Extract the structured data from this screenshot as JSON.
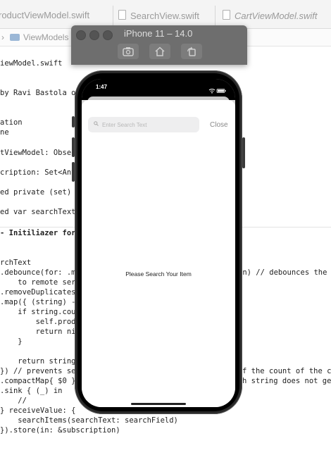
{
  "editor": {
    "tabs": [
      {
        "label": "roductViewModel.swift",
        "italic": false
      },
      {
        "label": "SearchView.swift",
        "italic": false
      },
      {
        "label": "CartViewModel.swift",
        "italic": true
      }
    ],
    "jump_segment": "ViewModels",
    "code_lines": [
      {
        "text": "iewModel.swift",
        "bold": false
      },
      {
        "text": "by Ravi Bastola o",
        "bold": false
      },
      {
        "text": "ation",
        "bold": false
      },
      {
        "text": "ne",
        "bold": false
      },
      {
        "text": "tViewModel: Obser",
        "bold": false
      },
      {
        "text": "cription: Set<Any",
        "bold": false
      },
      {
        "text": "ed private (set) ",
        "bold": false
      },
      {
        "text": "ed var searchText",
        "bold": false
      },
      {
        "text": "- Initiliazer for",
        "bold": true
      },
      {
        "text": "rchText",
        "bold": false
      },
      {
        "text": ".debounce(for: .m",
        "bold": false
      },
      {
        "text": "in) // debounces the",
        "bold": false
      },
      {
        "text": "    to remote ser",
        "bold": false
      },
      {
        "text": ".removeDuplicates",
        "bold": false
      },
      {
        "text": ".map({ (string) -",
        "bold": false
      },
      {
        "text": "    if string.cou",
        "bold": false
      },
      {
        "text": "        self.prod",
        "bold": false
      },
      {
        "text": "        return ni",
        "bold": false
      },
      {
        "text": "    }",
        "bold": false
      },
      {
        "text": "    return string",
        "bold": false
      },
      {
        "text": "}) // prevents se",
        "bold": false
      },
      {
        "text": "f the count of the ch",
        "bold": false
      },
      {
        "text": ".compactMap{ $0 }",
        "bold": false
      },
      {
        "text": "h string does not get",
        "bold": false
      },
      {
        "text": ".sink { (_) in",
        "bold": false
      },
      {
        "text": "    //",
        "bold": false
      },
      {
        "text": "} receiveValue: {",
        "bold": false
      },
      {
        "text": "    searchItems(searchText: searchField)",
        "bold": false
      },
      {
        "text": "}).store(in: &subscription)",
        "bold": false
      }
    ]
  },
  "simulator": {
    "title": "iPhone 11 – 14.0",
    "toolbar": [
      "screenshot-icon",
      "home-icon",
      "rotate-icon"
    ],
    "status_time": "1:47",
    "search": {
      "value": "",
      "placeholder": "Enter Search Text"
    },
    "close_label": "Close",
    "empty_message": "Please Search Your Item"
  }
}
